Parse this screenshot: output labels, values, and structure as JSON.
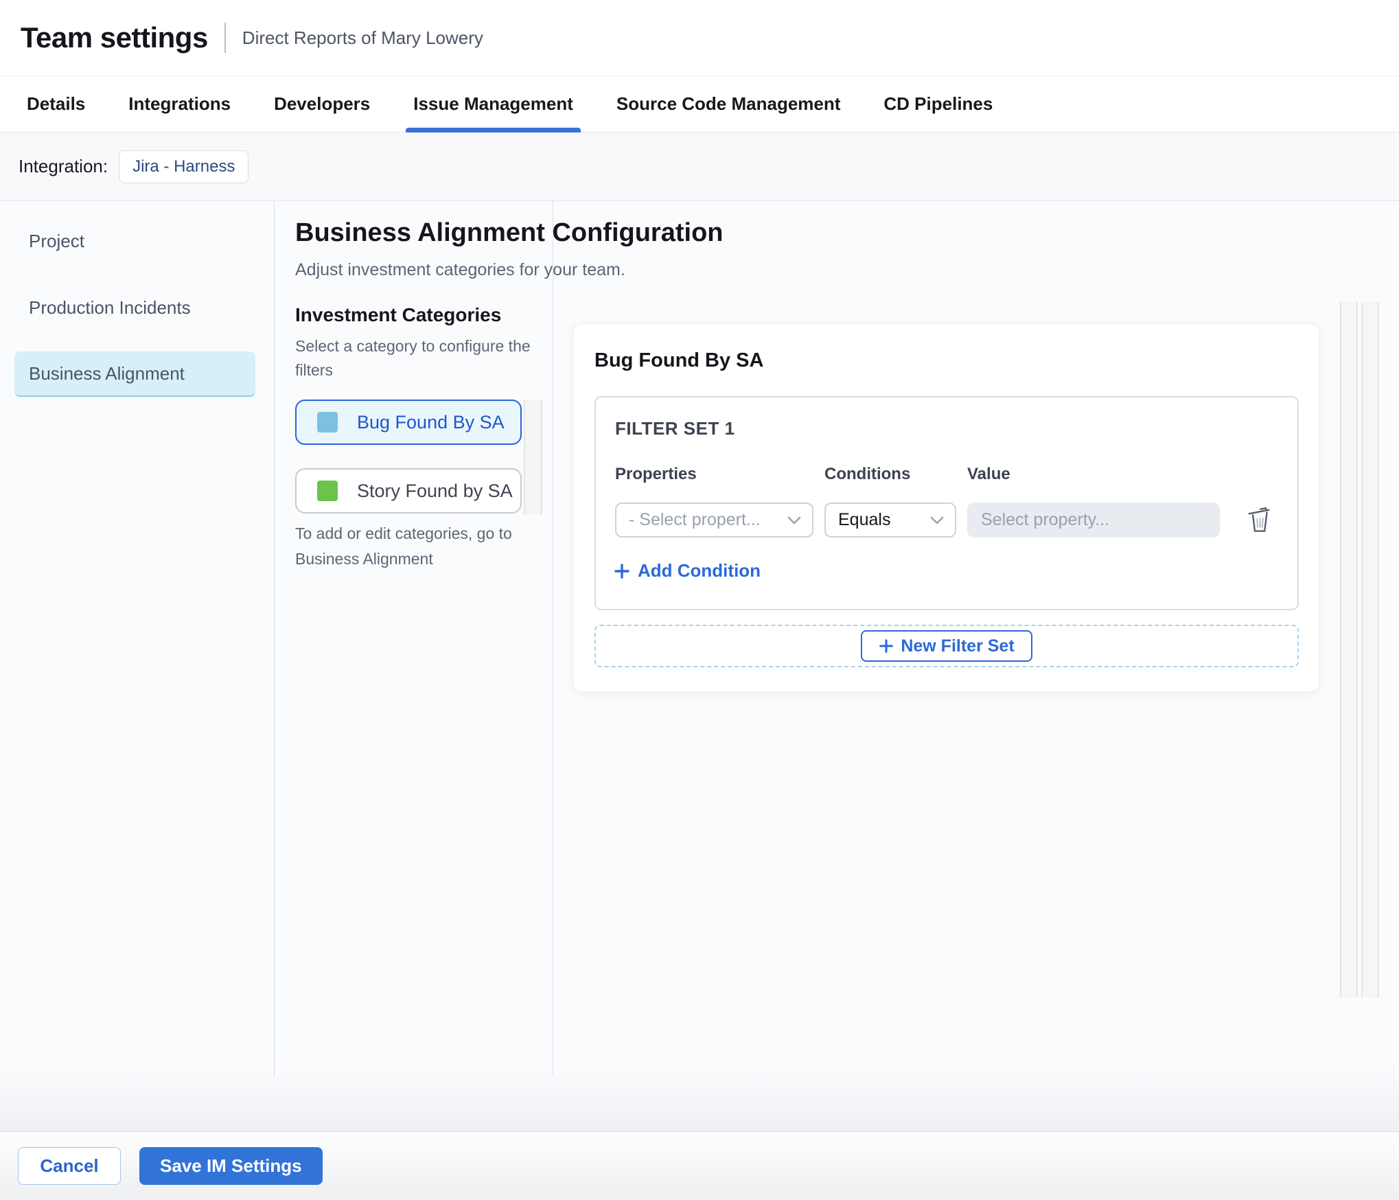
{
  "header": {
    "title": "Team settings",
    "subtitle": "Direct Reports of Mary Lowery"
  },
  "tabs": [
    {
      "label": "Details",
      "active": false
    },
    {
      "label": "Integrations",
      "active": false
    },
    {
      "label": "Developers",
      "active": false
    },
    {
      "label": "Issue Management",
      "active": true
    },
    {
      "label": "Source Code Management",
      "active": false
    },
    {
      "label": "CD Pipelines",
      "active": false
    }
  ],
  "integration": {
    "label": "Integration:",
    "chip_label": "Jira - Harness"
  },
  "sidebar": {
    "items": [
      {
        "label": "Project",
        "active": false
      },
      {
        "label": "Production Incidents",
        "active": false
      },
      {
        "label": "Business Alignment",
        "active": true
      }
    ]
  },
  "main": {
    "title": "Business Alignment Configuration",
    "subtitle": "Adjust investment categories for your team.",
    "categories": {
      "heading": "Investment Categories",
      "helper": "Select a category to configure the filters",
      "items": [
        {
          "label": "Bug Found By SA",
          "swatch_color": "#7DC1E1",
          "selected": true
        },
        {
          "label": "Story Found by SA",
          "swatch_color": "#6CC24A",
          "selected": false
        }
      ],
      "footnote": "To add or edit categories, go to Business Alignment"
    },
    "panel": {
      "title": "Bug Found By SA",
      "filter_set": {
        "title": "FILTER SET 1",
        "columns": {
          "properties": "Properties",
          "conditions": "Conditions",
          "value": "Value"
        },
        "property_placeholder": "- Select propert...",
        "condition_selected": "Equals",
        "value_placeholder": "Select property...",
        "add_condition_label": "Add Condition"
      },
      "new_filter_set_label": "New Filter Set"
    }
  },
  "footer": {
    "cancel_label": "Cancel",
    "save_label": "Save IM Settings"
  },
  "colors": {
    "accent_blue": "#2B69D6",
    "tab_underline": "#3A72D8",
    "selected_category_bg": "#EAF6FD",
    "selected_category_border": "#2962D9",
    "sidebar_active_bg": "#D6F0FA",
    "bug_swatch": "#7DC1E1",
    "story_swatch": "#6CC24A",
    "save_button_bg": "#3273D8"
  }
}
